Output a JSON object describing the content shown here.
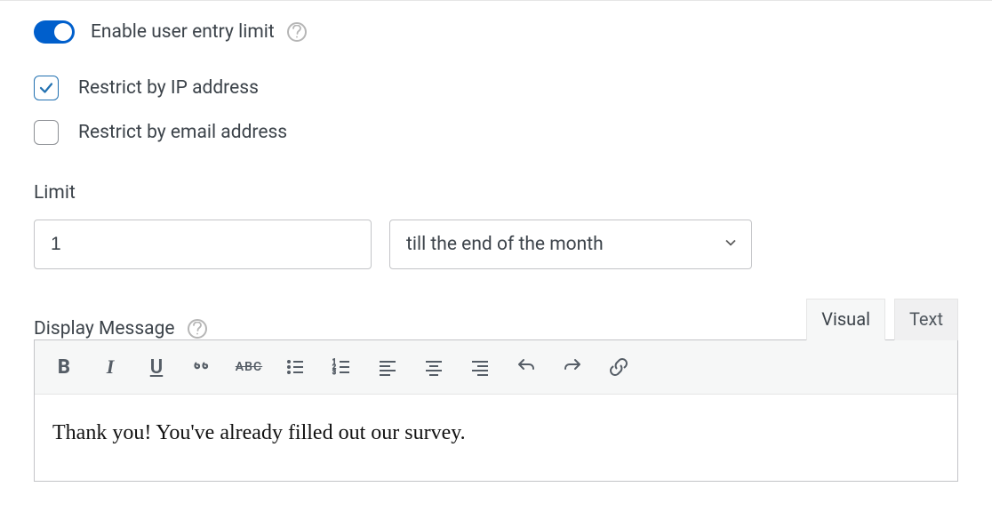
{
  "enable": {
    "label": "Enable user entry limit",
    "state": "on"
  },
  "restrict": {
    "ip": {
      "label": "Restrict by IP address",
      "checked": true
    },
    "email": {
      "label": "Restrict by email address",
      "checked": false
    }
  },
  "limit": {
    "label": "Limit",
    "value": "1",
    "period": "till the end of the month"
  },
  "displayMessage": {
    "label": "Display Message",
    "tabs": {
      "visual": "Visual",
      "text": "Text",
      "active": "visual"
    },
    "content": "Thank you! You've already filled out our survey."
  },
  "toolbar": [
    "bold",
    "italic",
    "underline",
    "blockquote",
    "strike",
    "ul",
    "ol",
    "align-left",
    "align-center",
    "align-right",
    "undo",
    "redo",
    "link"
  ]
}
